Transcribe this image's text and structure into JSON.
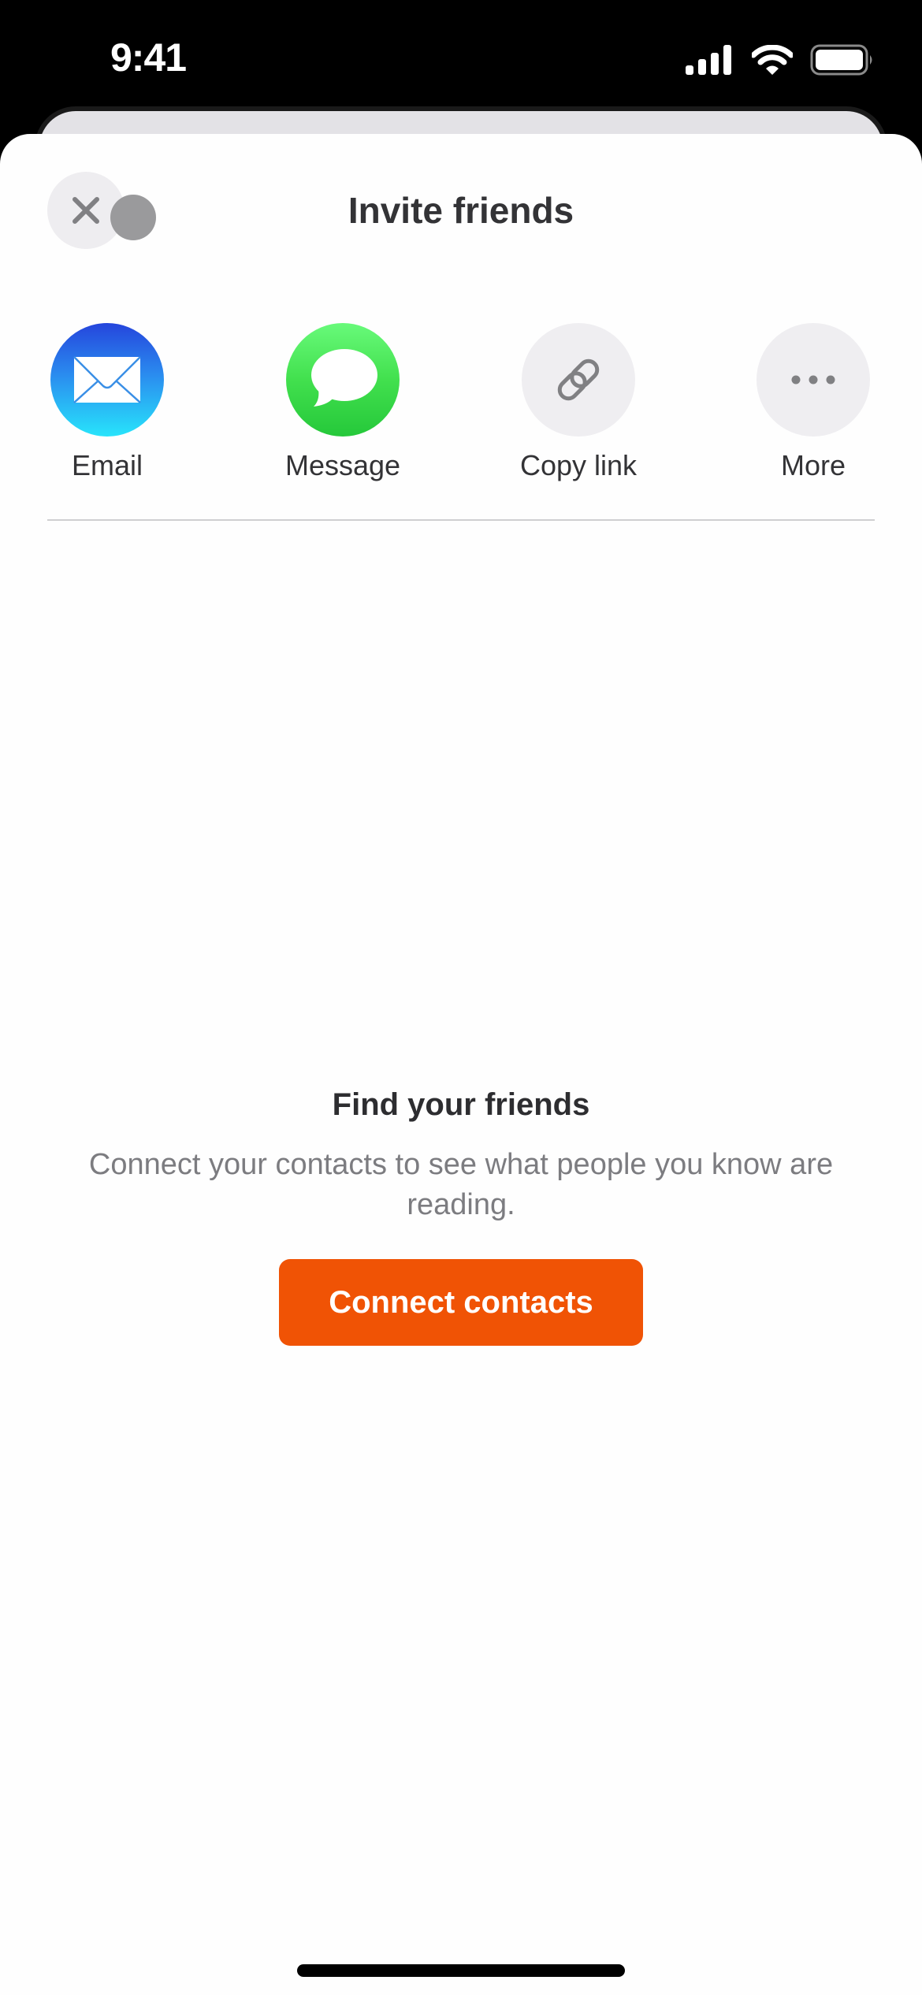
{
  "status_bar": {
    "time": "9:41",
    "icons": [
      "signal-icon",
      "wifi-icon",
      "battery-icon"
    ]
  },
  "sheet": {
    "title": "Invite friends",
    "close_icon": "close-icon"
  },
  "share_options": [
    {
      "label": "Email",
      "icon": "mail-icon",
      "colors": [
        "#2545dc",
        "#28e4fb"
      ]
    },
    {
      "label": "Message",
      "icon": "message-bubble-icon",
      "colors": [
        "#68fa7a",
        "#25c83a"
      ]
    },
    {
      "label": "Copy link",
      "icon": "link-icon",
      "colors": [
        "#efeef1"
      ]
    },
    {
      "label": "More",
      "icon": "ellipsis-icon",
      "colors": [
        "#efeef1"
      ]
    }
  ],
  "find_friends": {
    "title": "Find your friends",
    "description": "Connect your contacts to see what people you know are reading.",
    "button_label": "Connect contacts",
    "button_color": "#f05305"
  }
}
